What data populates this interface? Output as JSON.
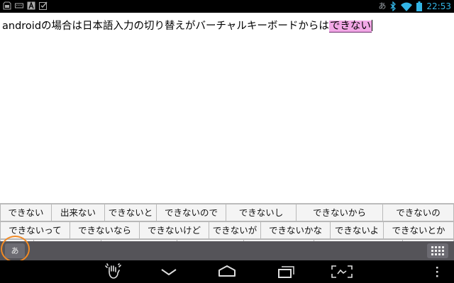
{
  "status_bar": {
    "ime_indicator": "あ",
    "time": "22:53",
    "left_icons": [
      "sd-card-icon",
      "keyboard-icon",
      "text-icon",
      "checkbox-icon"
    ],
    "right_icons": [
      "bluetooth-icon",
      "wifi-icon",
      "battery-icon"
    ],
    "accent_color": "#33b5e5"
  },
  "editor": {
    "committed_text": "androidの場合は日本語入力の切り替えがバーチャルキーボードからは",
    "composing_text": "できない",
    "composing_highlight_color": "#f2a8e6"
  },
  "candidates": {
    "row1": [
      "できない",
      "出来ない",
      "できないと",
      "できないので",
      "できないし",
      "できないから",
      "できないの"
    ],
    "row2": [
      "できないって",
      "できないなら",
      "できないけど",
      "できないが",
      "できないかな",
      "できないよ",
      "できないとか"
    ]
  },
  "keyboard": {
    "mode_label": "あ",
    "mode_highlight_color": "#f28a24",
    "toggle_icon": "keyboard-grid-icon"
  },
  "nav_bar": {
    "icons": [
      "hand-icon",
      "hide-keyboard-icon",
      "home-icon",
      "recent-apps-icon",
      "screenshot-icon",
      "menu-icon"
    ]
  }
}
